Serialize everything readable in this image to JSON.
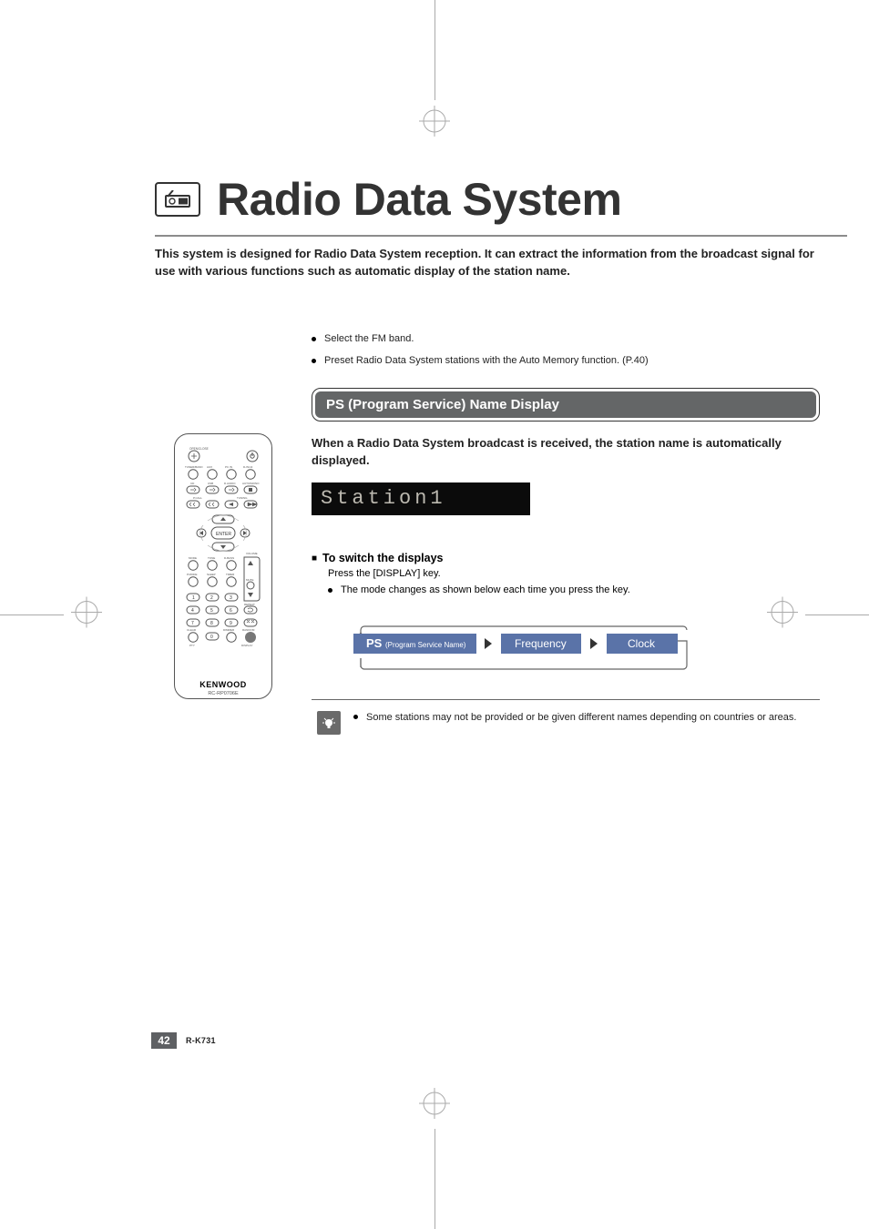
{
  "title": "Radio Data System",
  "intro": "This system is designed for Radio Data System reception. It can extract the information from the broadcast signal for use with various functions such as automatic display of the station name.",
  "pre_bullets": [
    "Select the FM band.",
    "Preset Radio Data System stations with the Auto Memory function. (P.40)"
  ],
  "section_heading": "PS (Program Service) Name Display",
  "section_lead": "When a Radio Data System broadcast is received, the station name is automatically displayed.",
  "lcd_text": "Station1",
  "switch": {
    "heading": "To switch the displays",
    "line": "Press the [DISPLAY] key.",
    "bullet": "The mode changes as shown below each time you press the key."
  },
  "flow": {
    "step1_main": "PS",
    "step1_sub": "(Program Service Name)",
    "step2": "Frequency",
    "step3": "Clock"
  },
  "note": "Some stations may not be provided or be given different names depending on countries or areas.",
  "remote": {
    "brand": "KENWOOD",
    "model": "RC-RP0706E"
  },
  "footer": {
    "page": "42",
    "model": "R-K731"
  }
}
